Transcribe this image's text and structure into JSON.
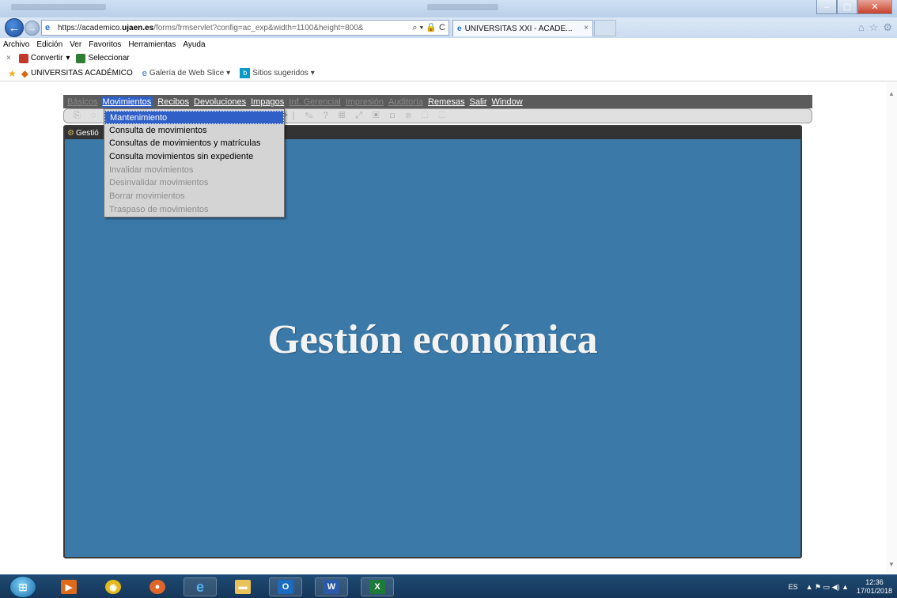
{
  "browser": {
    "url_prefix": "https://academico.",
    "url_domain": "ujaen.es",
    "url_rest": "/forms/frmservlet?config=ac_exp&width=1100&height=800&",
    "addr_tools": "⌕ ▾ 🔒 C",
    "tab_title": "UNIVERSITAS XXI - ACADE...",
    "tab_close": "×",
    "menus": [
      "Archivo",
      "Edición",
      "Ver",
      "Favoritos",
      "Herramientas",
      "Ayuda"
    ],
    "cmd_close": "×",
    "cmd_convert": "Convertir",
    "cmd_convert_caret": "▾",
    "cmd_select": "Seleccionar",
    "favorites": {
      "item1": "UNIVERSITAS ACADÉMICO",
      "item2": "Galería de Web Slice",
      "item3": "Sitios sugeridos",
      "caret": "▾"
    }
  },
  "app": {
    "menu": [
      {
        "label": "Básicos",
        "state": "disabled"
      },
      {
        "label": "Movimientos",
        "state": "active"
      },
      {
        "label": "Recibos",
        "state": "enabled"
      },
      {
        "label": "Devoluciones",
        "state": "enabled"
      },
      {
        "label": "Impagos",
        "state": "enabled"
      },
      {
        "label": "Inf. Gerencial",
        "state": "disabled"
      },
      {
        "label": "Impresión",
        "state": "disabled"
      },
      {
        "label": "Auditoría",
        "state": "disabled"
      },
      {
        "label": "Remesas",
        "state": "enabled"
      },
      {
        "label": "Salir",
        "state": "enabled"
      },
      {
        "label": "Window",
        "state": "enabled"
      }
    ],
    "toolbar_glyphs": "⎘ ◌ ▢ ⊡ ⤺ ⊞ ⊟ ◀◀ ◀ ▶ ▶▶ ▶| ✎ ? ▦ ⤢ ▣ ⊡ ⊗ ⬚ ⬚",
    "dropdown": [
      {
        "label": "Mantenimiento",
        "state": "selected"
      },
      {
        "label": "Consulta de movimientos",
        "state": "enabled"
      },
      {
        "label": "Consultas de movimientos y matrículas",
        "state": "enabled"
      },
      {
        "label": "Consulta movimientos sin expediente",
        "state": "enabled"
      },
      {
        "label": "Invalidar movimientos",
        "state": "disabled"
      },
      {
        "label": "Desinvalidar movimientos",
        "state": "disabled"
      },
      {
        "label": "Borrar movimientos",
        "state": "disabled"
      },
      {
        "label": "Traspaso de movimientos",
        "state": "disabled"
      }
    ],
    "window_title": "Gestió",
    "window_icon": "⚙",
    "banner": "Gestión económica"
  },
  "taskbar": {
    "tray_lang": "ES",
    "tray_icons": "▲ ⚑ ▭ ◀) ▲",
    "time": "12:36",
    "date": "17/01/2018"
  },
  "colors": {
    "app_background": "#3b79a9",
    "menu_highlight": "#2f5fc7",
    "menubar": "#5b5b5b"
  }
}
